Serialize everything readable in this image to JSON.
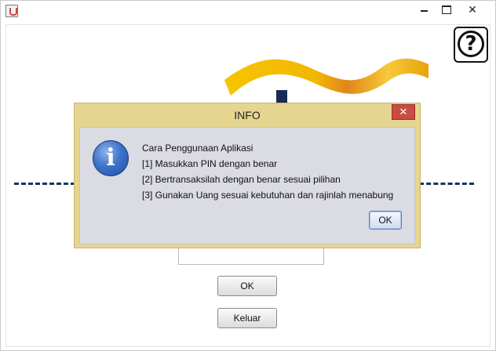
{
  "window": {
    "title": "",
    "controls": {
      "minimize": "",
      "maximize": "",
      "close": "✕"
    }
  },
  "help": {
    "symbol": "?"
  },
  "main": {
    "ok_label": "OK",
    "exit_label": "Keluar"
  },
  "dialog": {
    "title": "INFO",
    "close_symbol": "✕",
    "icon_symbol": "i",
    "message_lines": [
      "Cara Penggunaan Aplikasi",
      "[1] Masukkan PIN dengan benar",
      "[2] Bertransaksilah dengan benar sesuai pilihan",
      "[3] Gunakan Uang sesuai kebutuhan dan rajinlah menabung"
    ],
    "ok_label": "OK"
  },
  "colors": {
    "dialog_frame": "#e6d58f",
    "dialog_body": "#dadbe3",
    "close_red": "#c94c43",
    "ribbon_gold": "#f2b705",
    "dashed_navy": "#13355e"
  }
}
